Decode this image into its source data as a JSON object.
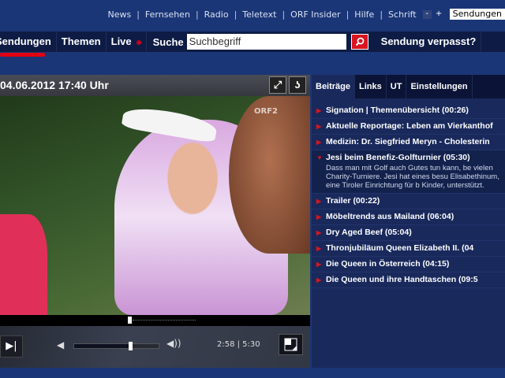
{
  "top_links": [
    "News",
    "Fernsehen",
    "Radio",
    "Teletext",
    "ORF Insider",
    "Hilfe",
    "Schrift"
  ],
  "font_minus": "-",
  "font_plus": "+",
  "sendungen_select": "Sendungen",
  "nav": {
    "items": [
      "Sendungen",
      "Themen",
      "Live"
    ],
    "search_label": "Suche",
    "search_value": "Suchbegriff",
    "verpasst": "Sendung verpasst?"
  },
  "player": {
    "title": "04.06.2012 17:40 Uhr",
    "channel_logo": "ORF2",
    "time": "2:58 | 5:30",
    "progress": 0.54,
    "volume": 0.66
  },
  "tabs": [
    "Beiträge",
    "Links",
    "UT",
    "Einstellungen"
  ],
  "items": [
    {
      "title": "Signation | Themenübersicht (00:26)"
    },
    {
      "title": "Aktuelle Reportage: Leben am Vierkanthof"
    },
    {
      "title": "Medizin: Dr. Siegfried Meryn - Cholesterin"
    },
    {
      "title": "Jesi beim Benefiz-Golfturnier (05:30)",
      "desc": [
        "Dass man mit Golf auch Gutes tun kann, be",
        "vielen Charity-Turniere. Jesi hat eines besu",
        "Elisabethinum, eine Tiroler Einrichtung für b",
        "Kinder, unterstützt."
      ]
    },
    {
      "title": "Trailer (00:22)"
    },
    {
      "title": "Möbeltrends aus Mailand (06:04)"
    },
    {
      "title": "Dry Aged Beef (05:04)"
    },
    {
      "title": "Thronjubiläum Queen Elizabeth II. (04"
    },
    {
      "title": "Die Queen in Österreich (04:15)"
    },
    {
      "title": "Die Queen und ihre Handtaschen (09:5"
    }
  ],
  "colors": {
    "accent": "#e3000f",
    "bg": "#1b3677"
  }
}
